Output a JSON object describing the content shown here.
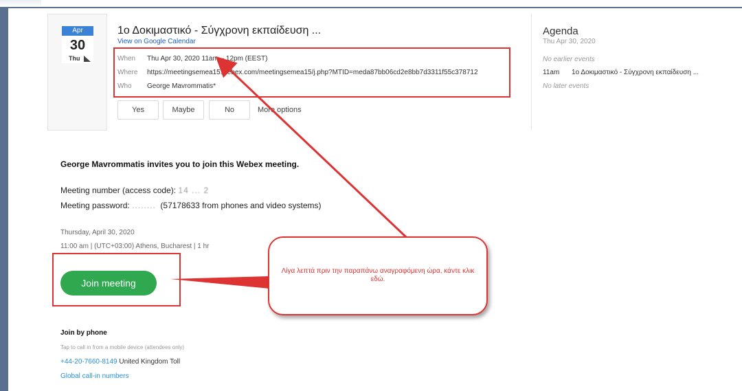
{
  "event": {
    "month": "Apr",
    "day": "30",
    "weekday": "Thu",
    "title": "1ο Δοκιμαστικό - Σύγχρονη εκπαίδευση ...",
    "calendar_link": "View on Google Calendar",
    "when_label": "When",
    "when_value": "Thu Apr 30, 2020 11am – 12pm (EEST)",
    "where_label": "Where",
    "where_value": "https://meetingsemea15.webex.com/meetingsemea15/j.php?MTID=meda87bb06cd2e8bb7d3311f55c378712",
    "who_label": "Who",
    "who_value": "George Mavrommatis*"
  },
  "rsvp": {
    "yes": "Yes",
    "maybe": "Maybe",
    "no": "No",
    "more": "More options"
  },
  "agenda": {
    "title": "Agenda",
    "date": "Thu Apr 30, 2020",
    "no_earlier": "No earlier events",
    "event_time": "11am",
    "event_title": "1ο Δοκιμαστικό - Σύγχρονη εκπαίδευση ...",
    "no_later": "No later events"
  },
  "invite": {
    "heading": "George Mavrommatis invites you to join this Webex meeting.",
    "number_label": "Meeting number (access code): ",
    "number_value": "14 ... 2",
    "password_label": "Meeting password: ",
    "password_value": "........",
    "password_suffix": "(57178633 from phones and video systems)",
    "date": "Thursday, April 30, 2020",
    "time": "11:00 am  |  (UTC+03:00) Athens, Bucharest  |  1 hr",
    "join_button": "Join meeting"
  },
  "phone": {
    "heading": "Join by phone",
    "subtext": "Tap to call in from a mobile device (attendees only)",
    "number": "+44-20-7660-8149",
    "number_suffix": " United Kingdom Toll",
    "global_link": "Global call-in numbers"
  },
  "annotation": {
    "callout_text": "Λίγα λεπτά πριν την παραπάνω αναγραφόμενη ώρα, κάντε κλικ εδώ.",
    "color": "#d33333"
  }
}
